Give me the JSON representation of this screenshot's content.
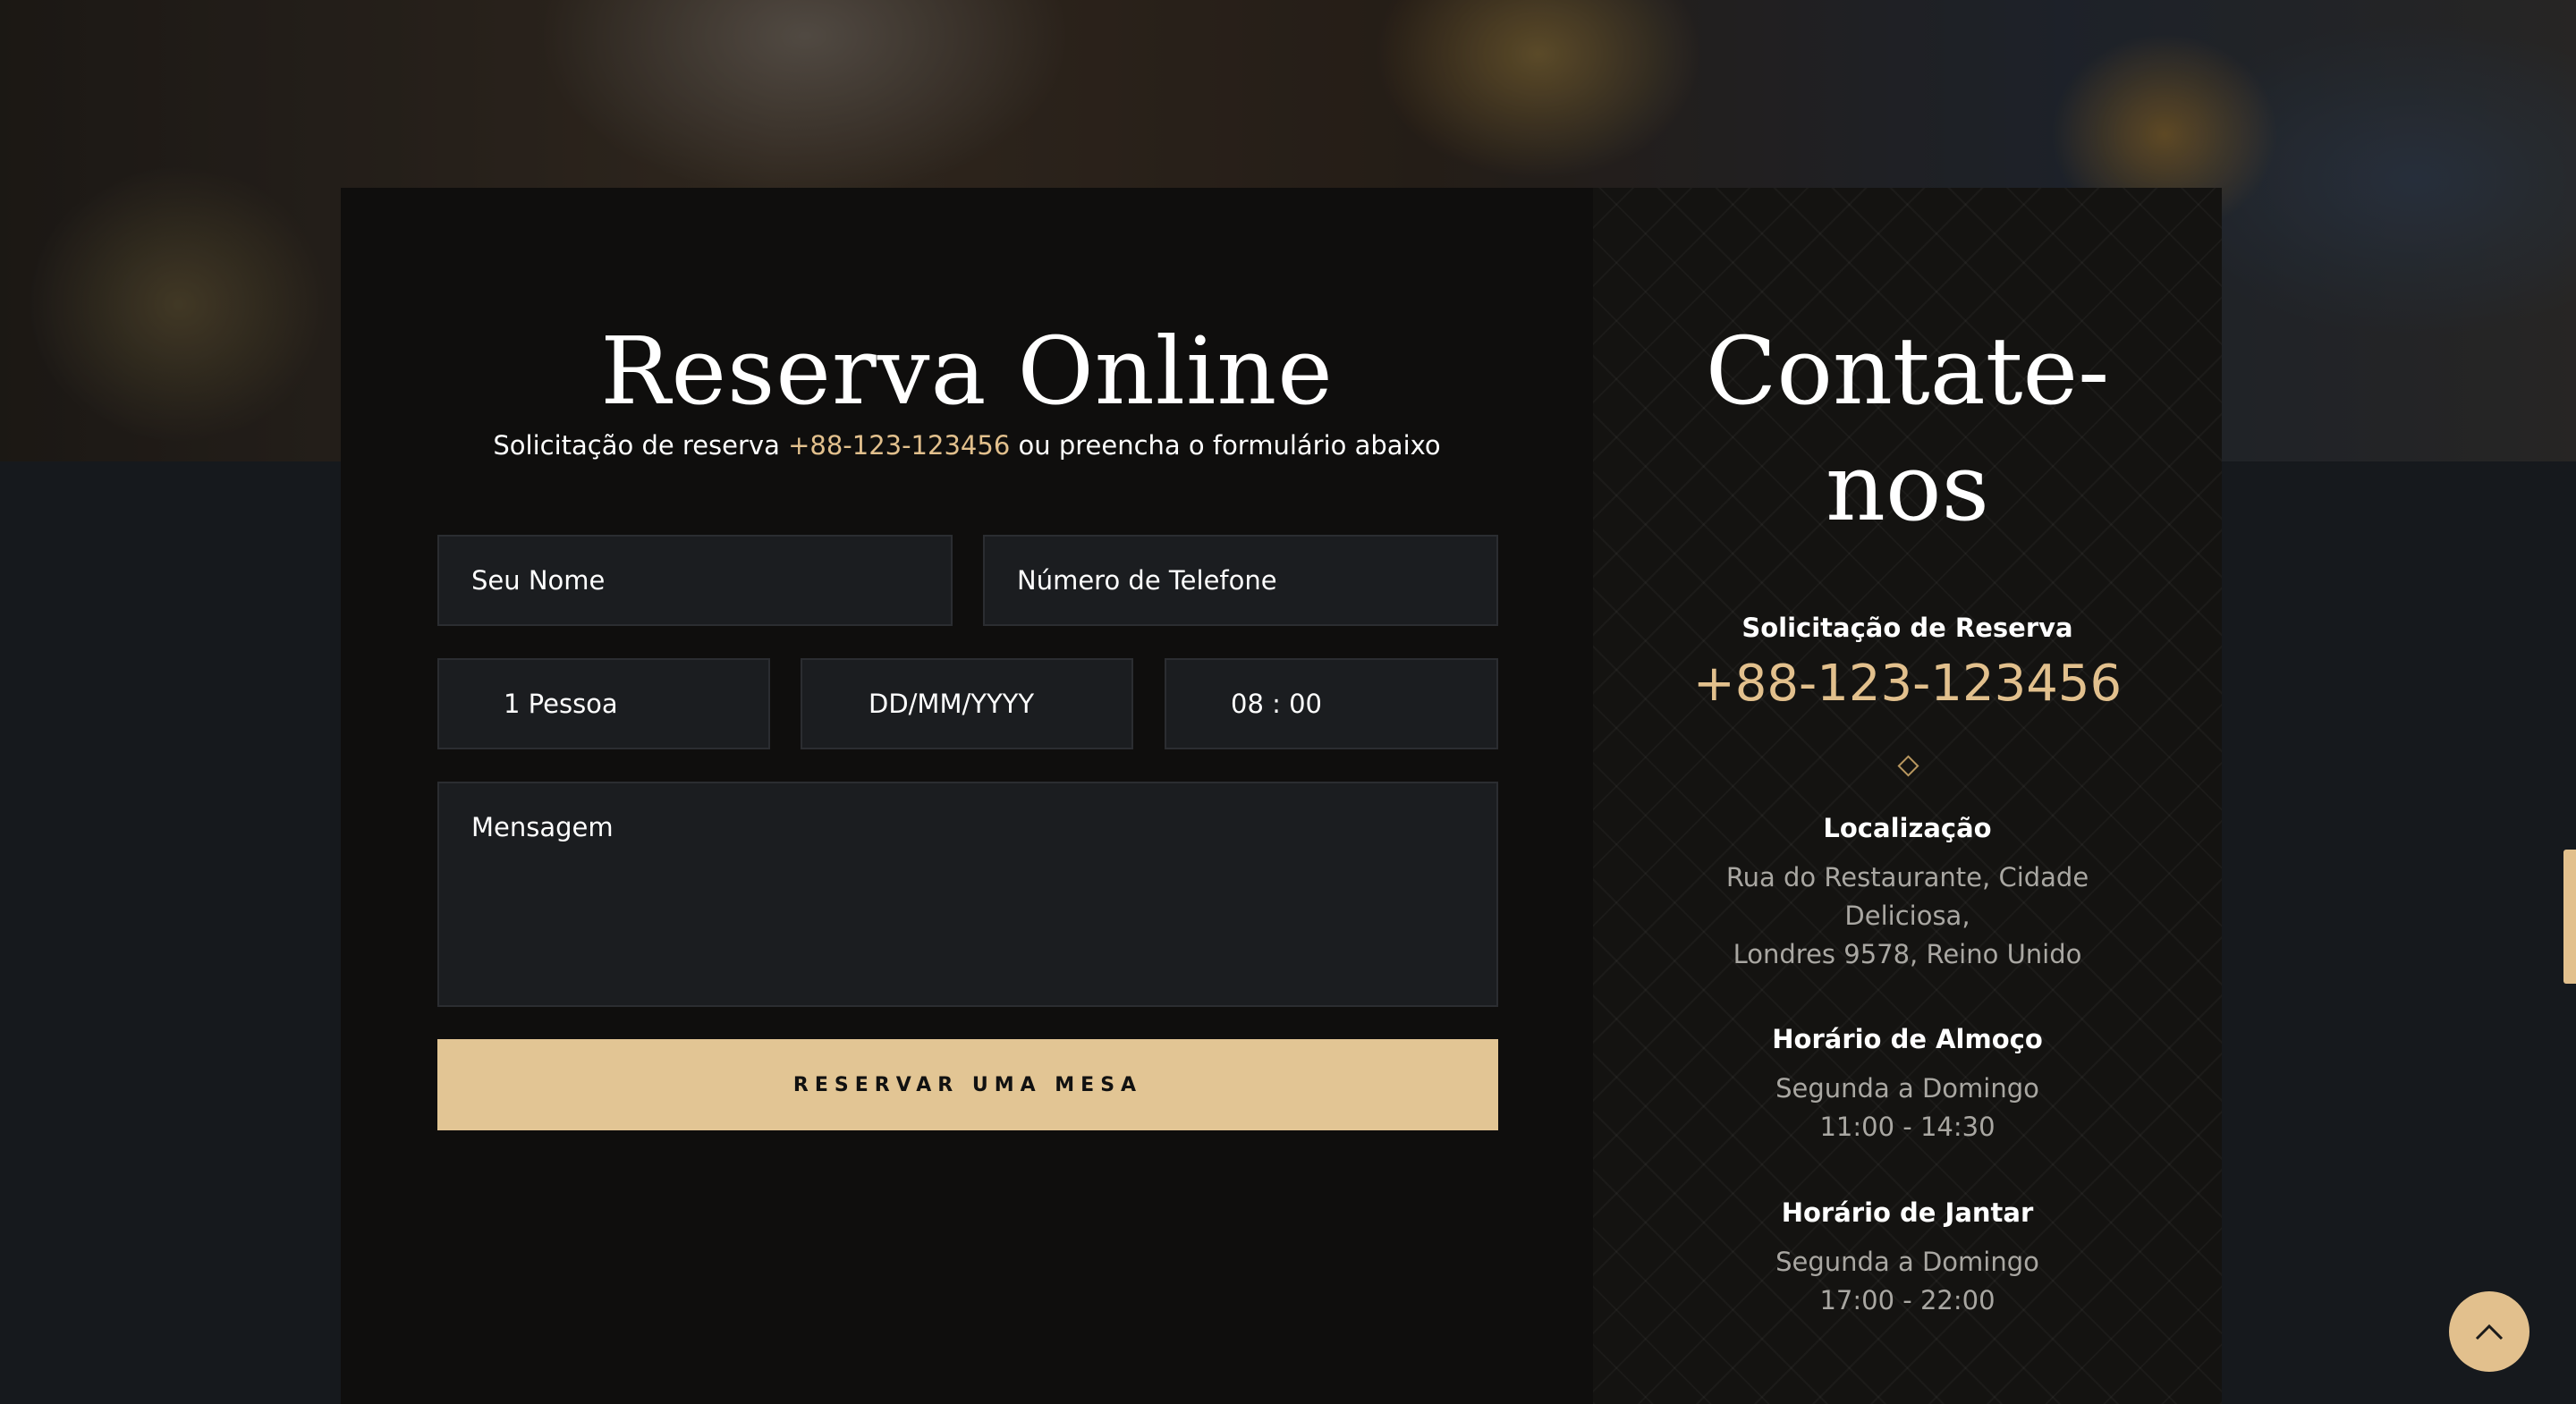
{
  "form": {
    "title": "Reserva Online",
    "subtitle_prefix": "Solicitação de reserva ",
    "subtitle_phone": "+88-123-123456",
    "subtitle_suffix": " ou preencha o formulário abaixo",
    "name_placeholder": "Seu Nome",
    "phone_placeholder": "Número de Telefone",
    "persons_value": "1 Pessoa",
    "date_placeholder": "DD/MM/YYYY",
    "time_value": "08 : 00",
    "message_placeholder": "Mensagem",
    "submit_label": "RESERVAR UMA MESA"
  },
  "contact": {
    "title_line1": "Contate-",
    "title_line2": "nos",
    "booking_heading": "Solicitação de Reserva",
    "booking_phone": "+88-123-123456",
    "location_heading": "Localização",
    "location_line1": "Rua do Restaurante, Cidade",
    "location_line2": "Deliciosa,",
    "location_line3": "Londres 9578, Reino Unido",
    "lunch_heading": "Horário de Almoço",
    "lunch_days": "Segunda a Domingo",
    "lunch_hours": "11:00 - 14:30",
    "dinner_heading": "Horário de Jantar",
    "dinner_days": "Segunda a Domingo",
    "dinner_hours": "17:00 - 22:00"
  },
  "colors": {
    "accent": "#e2c08d",
    "button": "#e2c594",
    "panel": "#0f0e0d",
    "page_bg": "#16191d",
    "field_bg": "#1b1d20"
  },
  "icons": {
    "back_to_top": "chevron-up-icon",
    "divider": "diamond-icon"
  }
}
